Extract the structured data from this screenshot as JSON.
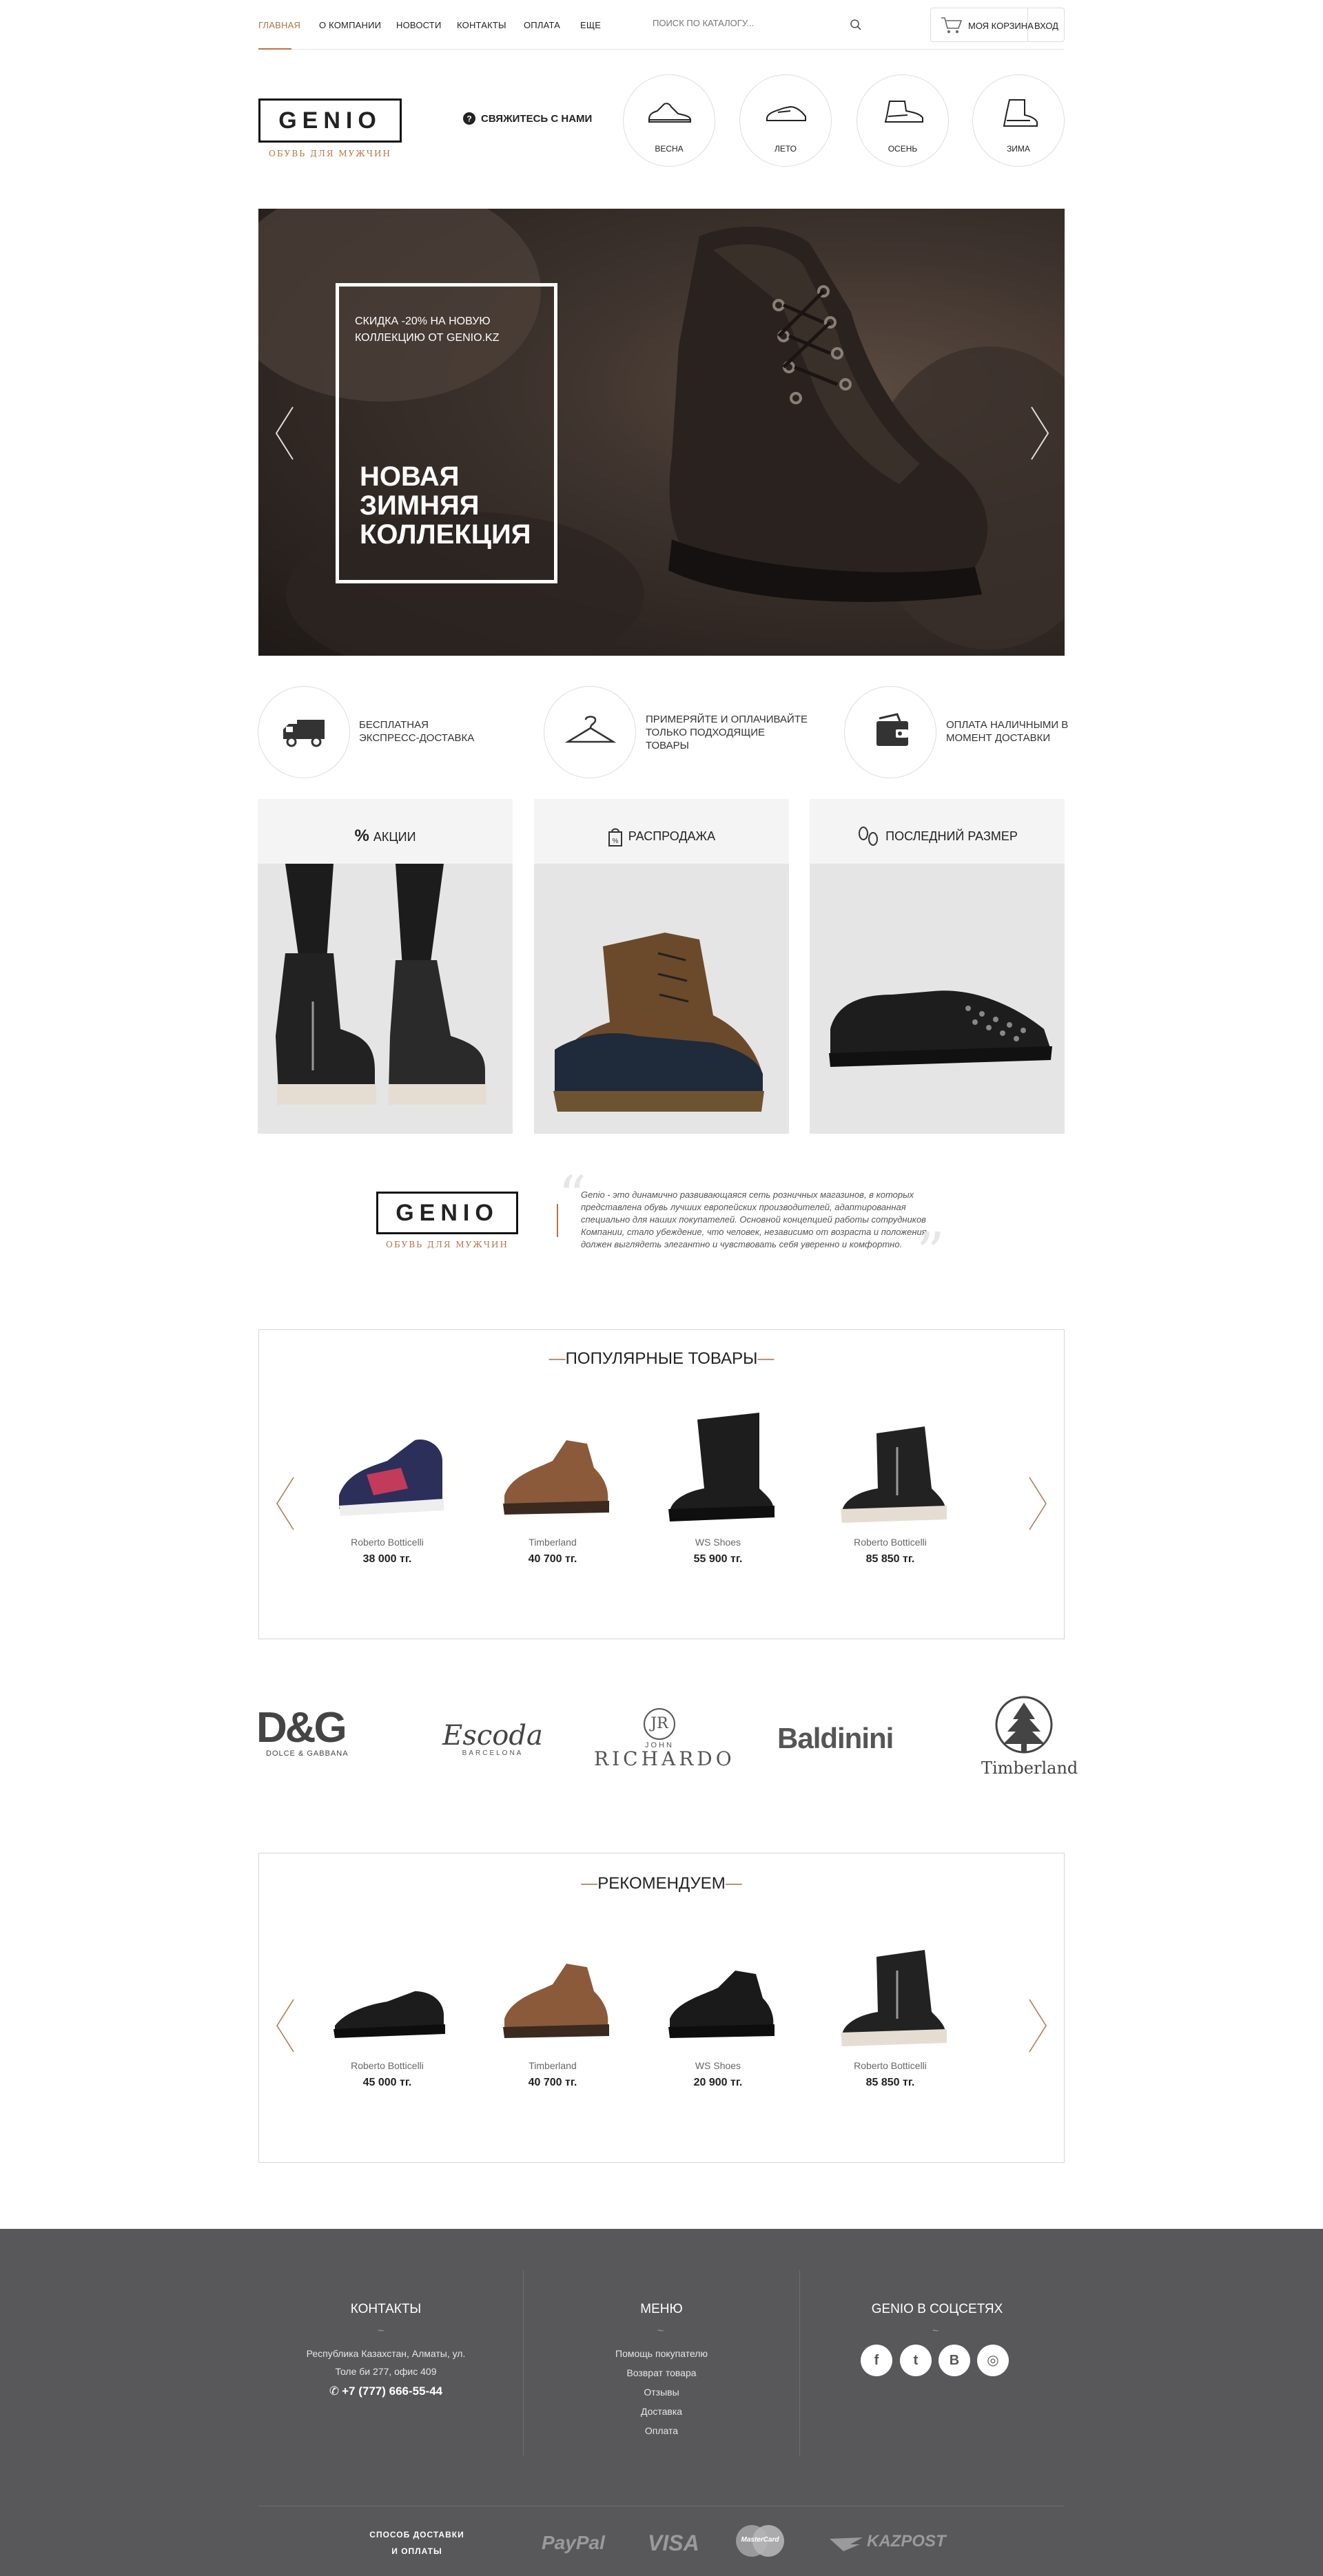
{
  "nav": {
    "items": [
      "ГЛАВНАЯ",
      "О КОМПАНИИ",
      "НОВОСТИ",
      "КОНТАКТЫ",
      "ОПЛАТА",
      "ЕЩЕ"
    ],
    "search_placeholder": "ПОИСК ПО КАТАЛОГУ...",
    "cart_label": "МОЯ КОРЗИНА",
    "login_label": "ВХОД"
  },
  "brand": {
    "logo": "GENIO",
    "tagline": "ОБУВЬ ДЛЯ МУЖЧИН"
  },
  "contact_link": "СВЯЖИТЕСЬ С НАМИ",
  "seasons": [
    "ВЕСНА",
    "ЛЕТО",
    "ОСЕНЬ",
    "ЗИМА"
  ],
  "hero": {
    "small_text": "СКИДКА -20% НА НОВУЮ КОЛЛЕКЦИЮ ОТ GENIO.KZ",
    "big_text": "НОВАЯ ЗИМНЯЯ КОЛЛЕКЦИЯ"
  },
  "features": [
    "БЕСПЛАТНАЯ ЭКСПРЕСС-ДОСТАВКА",
    "ПРИМЕРЯЙТЕ И ОПЛАЧИВАЙТЕ ТОЛЬКО ПОДХОДЯЩИЕ ТОВАРЫ",
    "ОПЛАТА НАЛИЧНЫМИ В МОМЕНТ ДОСТАВКИ"
  ],
  "categories": [
    "АКЦИИ",
    "РАСПРОДАЖА",
    "ПОСЛЕДНИЙ РАЗМЕР"
  ],
  "about": "Genio - это динамично развивающаяся сеть розничных магазинов, в которых представлена обувь лучших европейских производителей, адаптированная специально для наших покупателей. Основной концепцией работы сотрудников Компании, стало убеждение, что человек, независимо от возраста и положения, должен выглядеть элегантно и чувствовать себя уверенно и комфортно.",
  "popular": {
    "title": "ПОПУЛЯРНЫЕ ТОВАРЫ",
    "products": [
      {
        "brand": "Roberto Botticelli",
        "price": "38 000 тг."
      },
      {
        "brand": "Timberland",
        "price": "40 700 тг."
      },
      {
        "brand": "WS Shoes",
        "price": "55 900 тг."
      },
      {
        "brand": "Roberto Botticelli",
        "price": "85 850 тг."
      }
    ]
  },
  "brands": {
    "dg": "D&G",
    "dg_sub": "DOLCE & GABBANA",
    "escoda": "Escoda",
    "escoda_sub": "BARCELONA",
    "jr_mono": "JR",
    "jr_top": "JOHN",
    "jr_main": "RICHARDO",
    "baldinini": "Baldinini",
    "timberland": "Timberland"
  },
  "recommend": {
    "title": "РЕКОМЕНДУЕМ",
    "products": [
      {
        "brand": "Roberto Botticelli",
        "price": "45 000 тг."
      },
      {
        "brand": "Timberland",
        "price": "40 700 тг."
      },
      {
        "brand": "WS Shoes",
        "price": "20 900 тг."
      },
      {
        "brand": "Roberto Botticelli",
        "price": "85 850 тг."
      }
    ]
  },
  "footer": {
    "contacts_title": "КОНТАКТЫ",
    "address_line1": "Республика Казахстан, Алматы, ул.",
    "address_line2": "Толе би 277, офис 409",
    "phone": "+7 (777) 666-55-44",
    "menu_title": "МЕНЮ",
    "menu_items": [
      "Помощь покупателю",
      "Возврат товара",
      "Отзывы",
      "Доставка",
      "Оплата"
    ],
    "social_title": "GENIO В СОЦСЕТЯХ",
    "social": [
      "f",
      "t",
      "B",
      "◎"
    ],
    "payment_label_1": "СПОСОБ ДОСТАВКИ",
    "payment_label_2": "И ОПЛАТЫ",
    "payments": [
      "PayPal",
      "VISA",
      "MasterCard",
      "KAZPOST"
    ]
  },
  "colors": {
    "accent": "#b27348",
    "footer_bg": "#58585a"
  }
}
